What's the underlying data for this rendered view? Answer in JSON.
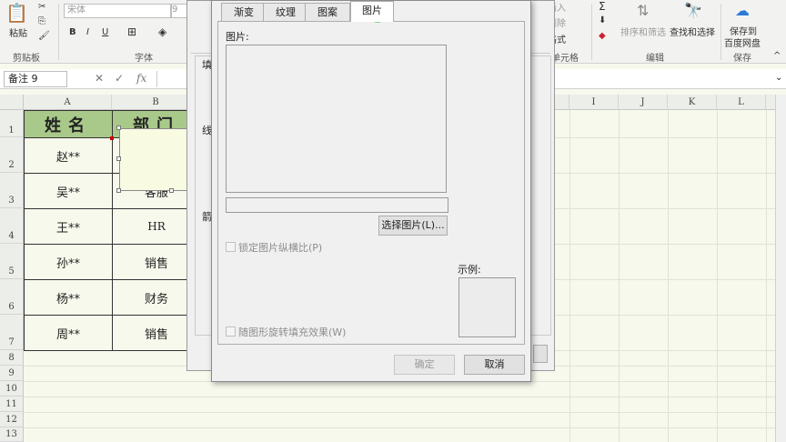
{
  "ribbon": {
    "clipboard": {
      "paste": "粘贴",
      "group": "剪贴板"
    },
    "font": {
      "name": "宋体",
      "size": "9",
      "group": "字体",
      "bold": "B",
      "italic": "I",
      "underline": "U"
    },
    "cells": {
      "insert": "插入",
      "delete": "删除",
      "format": "格式",
      "group": "单元格"
    },
    "editing": {
      "sort": "排序和筛选",
      "find": "查找和选择",
      "group": "编辑"
    },
    "save": {
      "label1": "保存到",
      "label2": "百度网盘",
      "group": "保存"
    }
  },
  "formula": {
    "namebox": "备注 9",
    "cancel": "✕",
    "enter": "✓",
    "fx": "fx"
  },
  "columns": [
    "A",
    "B",
    "I",
    "J",
    "K",
    "L"
  ],
  "rows": [
    "1",
    "2",
    "3",
    "4",
    "5",
    "6",
    "7",
    "8",
    "9",
    "10",
    "11",
    "12",
    "13"
  ],
  "table": {
    "headers": [
      "姓名",
      "部门"
    ],
    "names": [
      "赵**",
      "吴**",
      "王**",
      "孙**",
      "杨**",
      "周**"
    ],
    "depts": [
      "",
      "客服",
      "HR",
      "销售",
      "财务",
      "销售"
    ]
  },
  "back_dialog": {
    "fill_label": "填",
    "line_label": "线",
    "arrow_label": "箭"
  },
  "dialog": {
    "tabs": [
      "渐变",
      "纹理",
      "图案",
      "图片"
    ],
    "picture_label": "图片:",
    "select_button": "选择图片(L)...",
    "lock_aspect": "锁定图片纵横比(P)",
    "sample_label": "示例:",
    "rotate_fill": "随图形旋转填充效果(W)",
    "ok": "确定",
    "cancel": "取消"
  },
  "colors": {
    "header_fill": "#a9c98a",
    "sheet_bg": "#f6f9ec",
    "comment_fill": "#f8fbe2",
    "cursor_highlight": "#5cc05c"
  }
}
